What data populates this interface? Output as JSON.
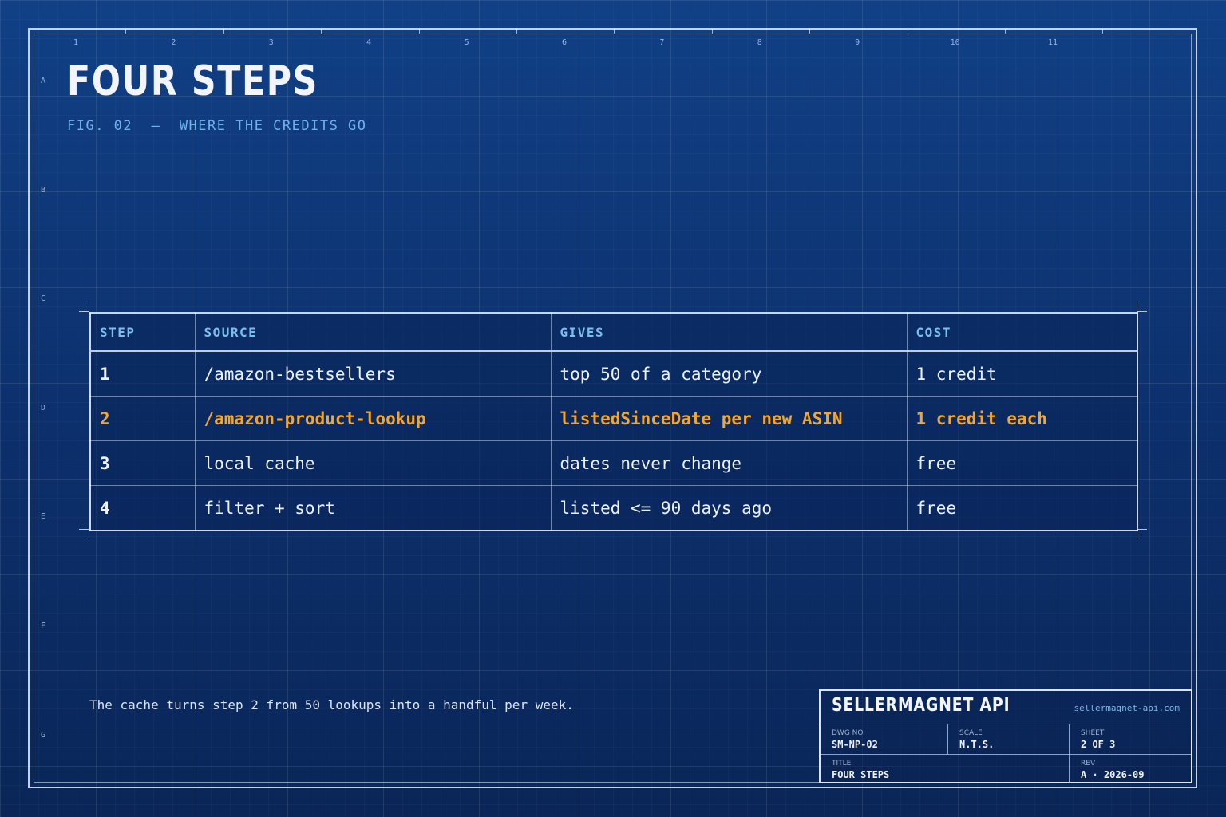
{
  "figure": {
    "title": "FOUR STEPS",
    "subtitle": "FIG. 02  —  WHERE THE CREDITS GO"
  },
  "grid_refs": {
    "columns": [
      "1",
      "2",
      "3",
      "4",
      "5",
      "6",
      "7",
      "8",
      "9",
      "10",
      "11"
    ],
    "rows": [
      "A",
      "B",
      "C",
      "D",
      "E",
      "F",
      "G"
    ]
  },
  "table": {
    "headers": [
      "STEP",
      "SOURCE",
      "GIVES",
      "COST"
    ],
    "rows": [
      {
        "step": "1",
        "source": "/amazon-bestsellers",
        "gives": "top 50 of a category",
        "cost": "1 credit",
        "highlight": false
      },
      {
        "step": "2",
        "source": "/amazon-product-lookup",
        "gives": "listedSinceDate per new ASIN",
        "cost": "1 credit each",
        "highlight": true
      },
      {
        "step": "3",
        "source": "local cache",
        "gives": "dates never change",
        "cost": "free",
        "highlight": false
      },
      {
        "step": "4",
        "source": "filter + sort",
        "gives": "listed <= 90 days ago",
        "cost": "free",
        "highlight": false
      }
    ]
  },
  "note": "The cache turns step 2 from 50 lookups into a handful per week.",
  "title_block": {
    "brand": "SELLERMAGNET API",
    "site": "sellermagnet-api.com",
    "dwg_no_label": "DWG NO.",
    "dwg_no": "SM-NP-02",
    "scale_label": "SCALE",
    "scale": "N.T.S.",
    "sheet_label": "SHEET",
    "sheet": "2 OF 3",
    "title_label": "TITLE",
    "title": "FOUR STEPS",
    "rev_label": "REV",
    "rev": "A · 2026-09"
  },
  "colors": {
    "background": "#0d3274",
    "accent_orange": "#f0a030",
    "header_blue": "#79bff0",
    "subtitle_blue": "#6fb3ec"
  }
}
